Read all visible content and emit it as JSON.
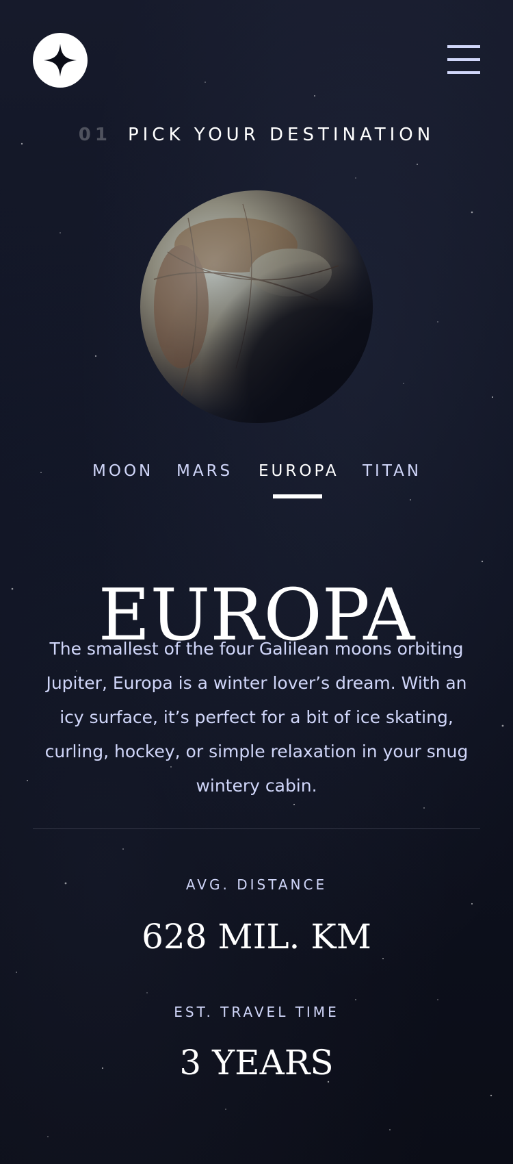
{
  "header": {
    "logo_icon": "star-logo-icon",
    "menu_icon": "hamburger-menu-icon"
  },
  "section": {
    "number": "01",
    "title": "PICK YOUR DESTINATION"
  },
  "planet": {
    "name": "Europa",
    "image_icon": "planet-europa-image"
  },
  "tabs": [
    {
      "label": "MOON",
      "active": false
    },
    {
      "label": "MARS",
      "active": false
    },
    {
      "label": "EUROPA",
      "active": true
    },
    {
      "label": "TITAN",
      "active": false
    }
  ],
  "destination": {
    "name": "EUROPA",
    "description": "The smallest of the four Galilean moons orbiting Jupiter, Europa is a winter lover’s dream. With an icy surface, it’s perfect for a bit of ice skating, curling, hockey, or simple relaxation in your snug wintery cabin."
  },
  "stats": {
    "distance_label": "AVG. DISTANCE",
    "distance_value": "628 MIL. KM",
    "travel_label": "EST. TRAVEL TIME",
    "travel_value": "3 YEARS"
  },
  "colors": {
    "background": "#0b0d17",
    "accent": "#d0d6f9",
    "text": "#ffffff"
  }
}
